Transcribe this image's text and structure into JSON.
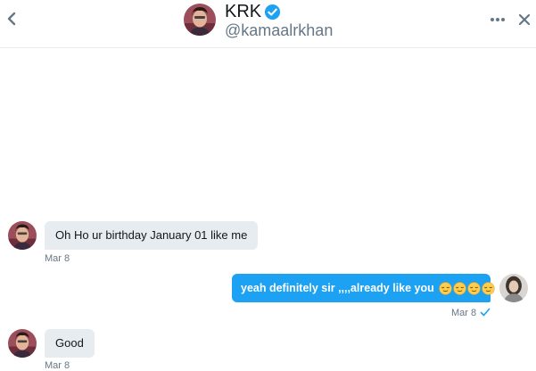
{
  "header": {
    "name": "KRK",
    "handle": "@kamaalrkhan",
    "back_icon": "chevron-left-icon",
    "verified_icon": "verified-badge-icon",
    "more_icon": "more-horizontal-icon",
    "close_icon": "close-icon"
  },
  "messages": [
    {
      "direction": "incoming",
      "text": "Oh Ho ur birthday January 01 like me",
      "time": "Mar 8"
    },
    {
      "direction": "outgoing",
      "text": "yeah definitely sir ,,,,already like you",
      "emoji": "relieved-face-icon",
      "emoji_count": 4,
      "time": "Mar 8",
      "status_icon": "sent-check-icon"
    },
    {
      "direction": "incoming",
      "text": "Good",
      "time": "Mar 8"
    }
  ],
  "colors": {
    "accent": "#1da1f2",
    "incoming_bubble": "#e6ecf0",
    "muted_text": "#657786",
    "primary_text": "#14171a"
  }
}
